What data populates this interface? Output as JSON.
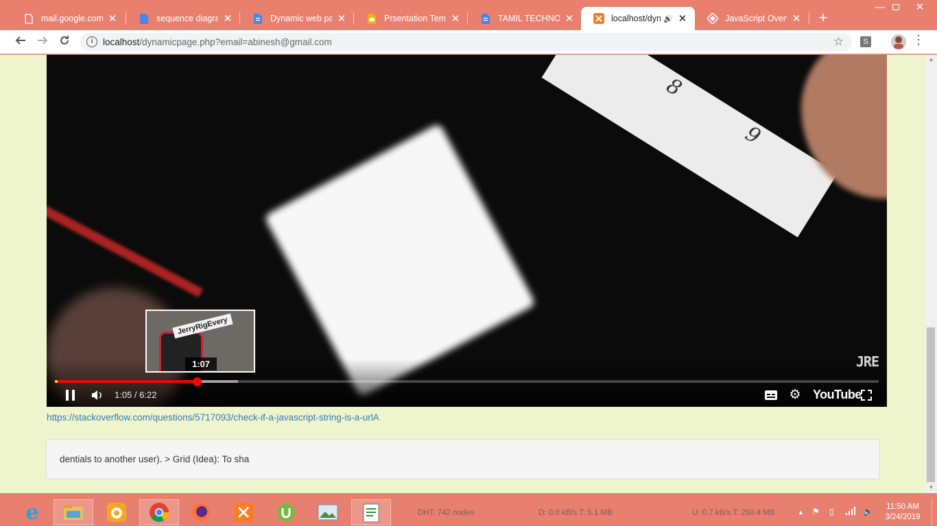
{
  "browser": {
    "tabs": [
      {
        "title": "mail.google.com",
        "icon": "page-icon",
        "active": false
      },
      {
        "title": "sequence diagram",
        "icon": "docs-icon",
        "active": false
      },
      {
        "title": "Dynamic web page",
        "icon": "docs-icon",
        "active": false
      },
      {
        "title": "Prsentation Templa",
        "icon": "slides-icon",
        "active": false
      },
      {
        "title": "TAMIL TECHNO-LE",
        "icon": "docs-icon",
        "active": false
      },
      {
        "title": "localhost/dyna",
        "icon": "xampp-icon",
        "active": true,
        "audio": true
      },
      {
        "title": "JavaScript Overview",
        "icon": "site-icon",
        "active": false
      }
    ],
    "url_host": "localhost",
    "url_path": "/dynamicpage.php?email=abinesh@gmail.com",
    "extension_label": "S"
  },
  "video": {
    "hover_time": "1:07",
    "thumb_label": "JerryRigEvery",
    "time_display": "1:05 / 6:22",
    "brand": "YouTube",
    "watermark": "JRE",
    "strip_numbers": [
      "8",
      "9"
    ],
    "progress_fraction": 0.172,
    "buffer_fraction": 0.222
  },
  "page": {
    "link": "https://stackoverflow.com/questions/5717093/check-if-a-javascript-string-is-a-urlA",
    "card_text": "dentials to another user). > Grid (Idea): To sha"
  },
  "taskbar": {
    "dht": "DHT: 742 nodes",
    "download": "D: 0.0 kB/s T: 5.1 MB",
    "upload": "U: 0.7 kB/s T: 250.4 MB",
    "time": "11:50 AM",
    "date": "3/24/2019"
  },
  "colors": {
    "accent": "#e9806e",
    "page_bg": "#eef5cd",
    "progress": "#ff0000",
    "link": "#3a77b5"
  }
}
